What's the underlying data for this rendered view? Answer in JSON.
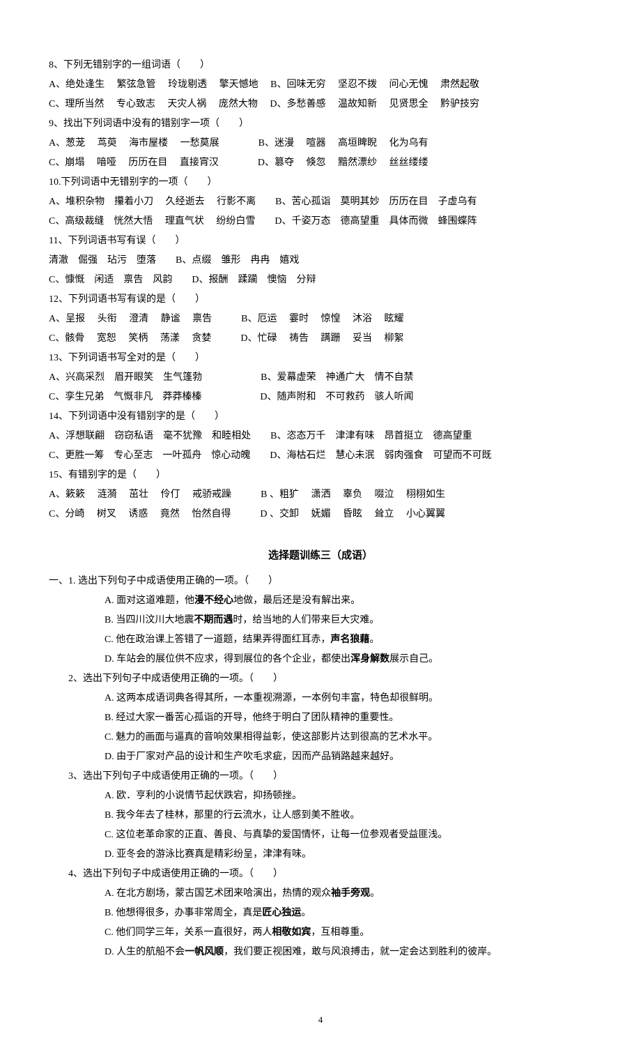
{
  "q8": {
    "text": "8、下列无错别字的一组词语（　　）",
    "a": "A、绝处逢生　 繁弦急管　 玲珑剔透　 擎天憾地　 B、回味无穷　 坚忍不拨　 问心无愧　 肃然起敬",
    "c": "C、理所当然　 专心致志　 天灾人祸　 庞然大物　 D、多愁善感　 温故知新　 见贤思全　 黔驴技穷"
  },
  "q9": {
    "text": "9、找出下列词语中没有的错别字一项（　　）",
    "a": "A、葱茏　 茑萸　 海市屋楼　 一愁莫展　　　　B、迷漫　 喧器　 高垣睥睨　 化为乌有",
    "c": "C、崩塌　 喑哑　 历历在目　 直接宵汉　　　　D、篡夺　 倏忽　 黯然漂纱　 丝丝缕缕"
  },
  "q10": {
    "text": "10.下列词语中无错别字的一项（　　）",
    "a": "A、堆积杂物　攥着小刀　 久经逝去　 行影不离　　B、苦心孤诣　莫明其妙　历历在目　子虚乌有",
    "c": "C、高级裁缝　恍然大悟　 理直气状　 纷纷白雪　　D、千姿万态　德高望重　具体而微　蜂围蝶阵"
  },
  "q11": {
    "text": "11、下列词语书写有误（　　）",
    "a": "清澈　倔强　玷污　堕落　　B、点缀　雏形　冉冉　嬉戏",
    "c": "C、慷慨　闲适　禀告　风韵　　D、报酬　蹂躏　懊恼　分辩"
  },
  "q12": {
    "text": "12、下列词语书写有误的是（　　）",
    "a": "A、呈报　 头衔　 澄清　 静谧　 禀告　　　B、厄运　 霎时　 惊惶　 沐浴　 眩耀",
    "c": "C、骸骨　 宽恕　 笑柄　 荡漾　 贪婪　　　D、忙碌　 祷告　 蹒跚　 妥当　 柳絮"
  },
  "q13": {
    "text": "13、下列词语书写全对的是（　　）",
    "a": "A、兴高采烈　眉开眼笑　生气篷勃　　　　　　B、爱幕虚荣　神通广大　情不自禁",
    "c": "C、孪生兄弟　气慨非凡　莽莽榛榛　　　　　　D、随声附和　不可救药　骇人听闻"
  },
  "q14": {
    "text": "14、下列词语中没有错别字的是（　　）",
    "a": "A、浮想联翩　窃窃私语　毫不犹豫　和睦相处　　B、恣态万千　津津有味　昂首挺立　德高望重",
    "c": "C、更胜一筹　专心至志　一叶孤舟　惊心动魄　　D、海枯石烂　慧心未泯　弱肉强食　可望而不可既"
  },
  "q15": {
    "text": "15、有错别字的是（　　）",
    "a": "A、簌簌　 涟漪　 茁壮　 伶仃　 戒骄戒躁　　　B 、粗犷　 潇洒　 辜负　 啜泣　 栩栩如生",
    "c": "C、分崎　 树叉　 诱惑　 竟然　 怡然自得　　　D 、交卸　 妩媚　 昏眩　 耸立　 小心翼翼"
  },
  "section_title": "选择题训练三（成语）",
  "s2_q1": {
    "text": "一、1. 选出下列句子中成语使用正确的一项。（　　）",
    "a_pre": "A. 面对这道难题，他",
    "a_b": "漫不经心",
    "a_post": "地做，最后还是没有解出来。",
    "b_pre": "B. 当四川汶川大地震",
    "b_b": "不期而遇",
    "b_post": "时，给当地的人们带来巨大灾难。",
    "c_pre": "C. 他在政治课上答错了一道题，结果弄得面红耳赤，",
    "c_b": "声名狼藉",
    "c_post": "。",
    "d_pre": "D. 车站会的展位供不应求，得到展位的各个企业，都使出",
    "d_b": "浑身解数",
    "d_post": "展示自己。"
  },
  "s2_q2": {
    "text": "2、选出下列句子中成语使用正确的一项。（　　）",
    "a": "A. 这两本成语词典各得其所，一本重视溯源，一本例句丰富，特色却很鲜明。",
    "b": "B. 经过大家一番苦心孤诣的开导，他终于明白了团队精神的重要性。",
    "c": "C. 魅力的画面与逼真的音响效果相得益彰，使这部影片达到很高的艺术水平。",
    "d": "D. 由于厂家对产品的设计和生产吹毛求疵，因而产品销路越来越好。"
  },
  "s2_q3": {
    "text": "3、选出下列句子中成语使用正确的一项。（　　）",
    "a": "A. 欧．亨利的小说情节起伏跌宕，抑扬顿挫。",
    "b": "B. 我今年去了桂林，那里的行云流水，让人感到美不胜收。",
    "c": "C. 这位老革命家的正直、善良、与真挚的爱国情怀，让每一位参观者受益匪浅。",
    "d": "D. 亚冬会的游泳比赛真是精彩纷呈，津津有味。"
  },
  "s2_q4": {
    "text": "4、选出下列句子中成语使用正确的一项。（　　）",
    "a_pre": "A. 在北方剧场，蒙古国艺术团来哈演出，热情的观众",
    "a_b": "袖手旁观",
    "a_post": "。",
    "b_pre": "B. 他想得很多，办事非常周全，真是",
    "b_b": "匠心独运",
    "b_post": "。",
    "c_pre": "C. 他们同学三年，关系一直很好，两人",
    "c_b": "相敬如宾",
    "c_post": "，互相尊重。",
    "d_pre": "D. 人生的航船不会",
    "d_b": "一帆风顺",
    "d_post": "，我们要正视困难，敢与风浪搏击，就一定会达到胜利的彼岸。"
  },
  "page_number": "4"
}
